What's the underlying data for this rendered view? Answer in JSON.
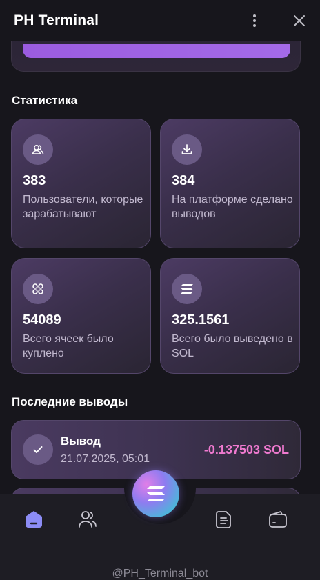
{
  "header": {
    "title": "PH Terminal"
  },
  "stats": {
    "section_title": "Статистика",
    "cards": [
      {
        "value": "383",
        "label": "Пользователи, которые зарабатывают",
        "icon": "users-icon"
      },
      {
        "value": "384",
        "label": "На платформе сделано выводов",
        "icon": "download-icon"
      },
      {
        "value": "54089",
        "label": "Всего ячеек было куплено",
        "icon": "grid-icon"
      },
      {
        "value": "325.1561",
        "label": "Всего было выведено в SOL",
        "icon": "solana-icon"
      }
    ]
  },
  "withdrawals": {
    "section_title": "Последние выводы",
    "items": [
      {
        "title": "Вывод",
        "date": "21.07.2025, 05:01",
        "amount": "-0.137503 SOL"
      }
    ]
  },
  "nav": {
    "items": [
      "home-icon",
      "users-icon",
      "solana-icon",
      "document-icon",
      "wallet-icon"
    ],
    "active": "home-icon"
  },
  "footer": {
    "handle": "@PH_Terminal_bot"
  },
  "colors": {
    "background": "#17161c",
    "card": "#3d3250",
    "accent": "#8e7cf0",
    "amount_negative": "#f07ad0",
    "nav_active": "#8c8cf5"
  }
}
